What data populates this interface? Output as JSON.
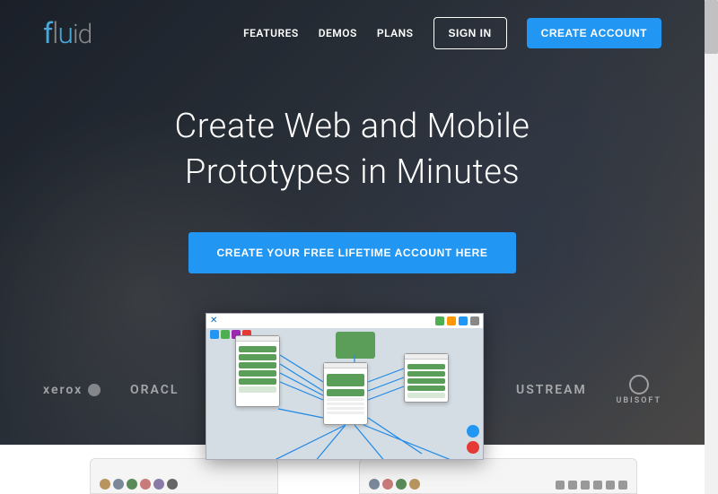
{
  "logo": "fluid",
  "nav": {
    "features": "FEATURES",
    "demos": "DEMOS",
    "plans": "PLANS",
    "signin": "SIGN IN",
    "create": "CREATE ACCOUNT"
  },
  "hero": {
    "line1": "Create Web and Mobile",
    "line2": "Prototypes in Minutes",
    "cta": "CREATE YOUR FREE LIFETIME ACCOUNT HERE"
  },
  "brands": {
    "xerox": "xerox",
    "oracle": "ORACL",
    "ustream": "USTREAM",
    "ubisoft": "UBISOFT"
  },
  "colors": {
    "primary": "#2196f3",
    "logoBlue": "#4aa8d8"
  }
}
